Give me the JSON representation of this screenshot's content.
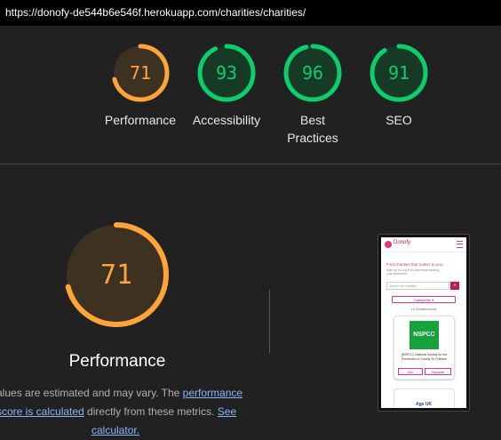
{
  "url": "https://donofy-de544b6e546f.herokuapp.com/charities/charities/",
  "colors": {
    "average": "#ffa43a",
    "pass": "#0cce6b",
    "average_fill": "#3d3121",
    "pass_fill": "#173a27"
  },
  "gauges": [
    {
      "score": "71",
      "label": "Performance",
      "status": "average"
    },
    {
      "score": "93",
      "label": "Accessibility",
      "status": "pass"
    },
    {
      "score": "96",
      "label": "Best\nPractices",
      "status": "pass"
    },
    {
      "score": "91",
      "label": "SEO",
      "status": "pass"
    }
  ],
  "performance": {
    "score": "71",
    "title": "Performance",
    "desc_prefix": "alues are estimated and may vary. The ",
    "link1": "performance",
    "link1b": "score is calculated",
    "desc_middle": " directly from these metrics. ",
    "link2": "See",
    "link2b": "calculator."
  },
  "preview": {
    "brand": "Donofy",
    "headline": "Find charities that matter to you.",
    "subtext": "Sign up or Log in to start bookmarking your favourites.",
    "search_placeholder": "Search our charities",
    "search_button": "⌕",
    "categories": "Categories ▾",
    "found": "15 Charities found",
    "card_logo": "NSPCC",
    "card_desc": "(NSPCC) National Society for the Prevention of Cruelty To Children",
    "info_button": "Info",
    "fav_button": "Favourite",
    "next_logo": "Age UK"
  }
}
